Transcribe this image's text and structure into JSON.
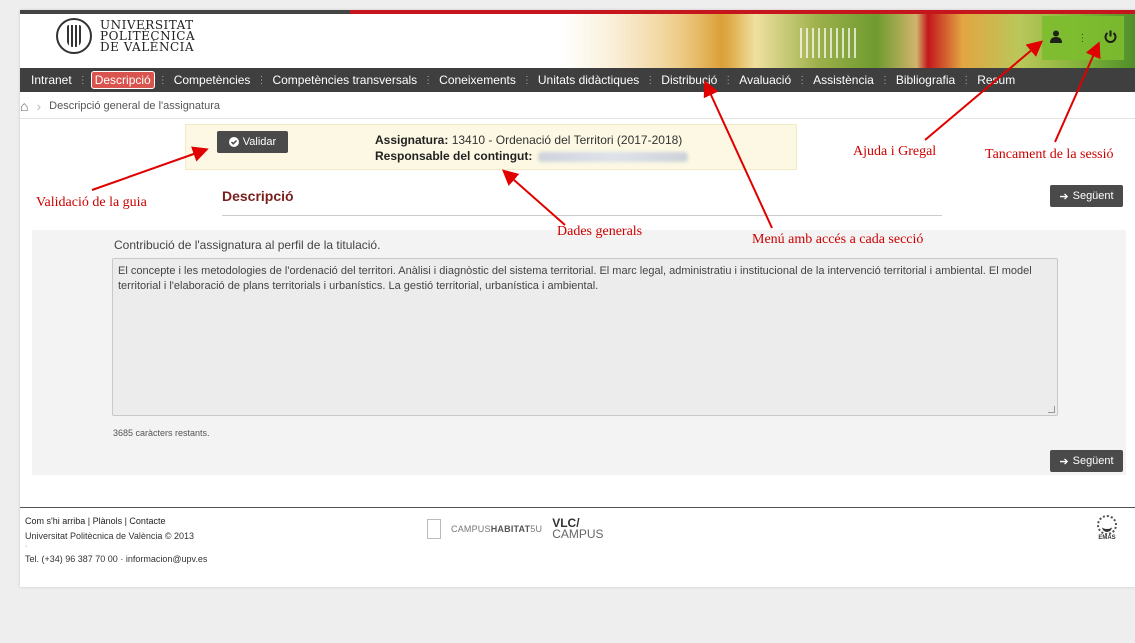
{
  "header": {
    "university_name": [
      "UNIVERSITAT",
      "POLITÈCNICA",
      "DE VALÈNCIA"
    ],
    "user_icon": "user-icon",
    "power_icon": "power-icon"
  },
  "nav": {
    "items": [
      {
        "label": "Intranet",
        "active": false
      },
      {
        "label": "Descripció",
        "active": true
      },
      {
        "label": "Competències",
        "active": false
      },
      {
        "label": "Competències transversals",
        "active": false
      },
      {
        "label": "Coneixements",
        "active": false
      },
      {
        "label": "Unitats didàctiques",
        "active": false
      },
      {
        "label": "Distribució",
        "active": false
      },
      {
        "label": "Avaluació",
        "active": false
      },
      {
        "label": "Assistència",
        "active": false
      },
      {
        "label": "Bibliografia",
        "active": false
      },
      {
        "label": "Resum",
        "active": false
      }
    ]
  },
  "breadcrumb": {
    "current": "Descripció general de l'assignatura"
  },
  "info": {
    "validate_label": "Validar",
    "subject_label": "Assignatura:",
    "subject_value": "13410 - Ordenació del Territori (2017-2018)",
    "owner_label": "Responsable del contingut:"
  },
  "main": {
    "section_title": "Descripció",
    "next_label": "Següent",
    "question": "Contribució de l'assignatura al perfil de la titulació.",
    "text_value": "El concepte i les metodologies de l'ordenació del territori. Anàlisi i diagnòstic del sistema territorial. El marc legal, administratiu i institucional de la intervenció territorial i ambiental. El model territorial i l'elaboració de plans territorials i urbanístics. La gestió territorial, urbanística i ambiental.",
    "remaining": "3685 caràcters restants."
  },
  "footer": {
    "links": "Com s'hi arriba | Plànols | Contacte",
    "copyright": "Universitat Politècnica de València © 2013",
    "dot": "·",
    "contact": "Tel. (+34) 96 387 70 00 · informacion@upv.es",
    "campus_habitat_1": "CAMPUS",
    "campus_habitat_2": "HABITAT",
    "campus_habitat_3": "5U",
    "vlc_1": "VLC/",
    "vlc_2": "CAMPUS",
    "emas": "EMAS"
  },
  "annotations": {
    "validation": "Validació de la guia",
    "general_data": "Dades generals",
    "menu": "Menú amb accés a cada secció",
    "help": "Ajuda i Gregal",
    "logout": "Tancament de la sessió"
  },
  "colors": {
    "annotation_red": "#cc0000",
    "nav_bg": "#3f3f3f",
    "active_tab": "#d9534f",
    "section_title": "#7a1e1e"
  }
}
